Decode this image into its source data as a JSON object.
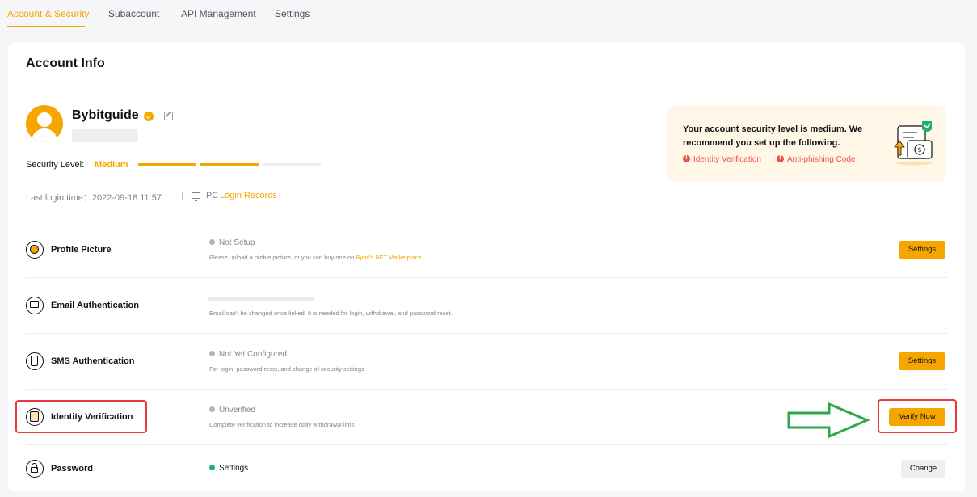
{
  "tabs": [
    "Account & Security",
    "Subaccount",
    "API Management",
    "Settings"
  ],
  "page_title": "Account Info",
  "profile": {
    "username": "Bybitguide",
    "security_label": "Security Level:",
    "security_value": "Medium",
    "security_level": "2 of 3",
    "last_login": "Last login time：2022-09-18 11:57",
    "login_separator": "|",
    "login_device": "PC",
    "login_records": "Login Records"
  },
  "notice": {
    "text": "Your account security level is medium. We recommend you set up the following.",
    "items": [
      "Identity Verification",
      "Anti-phishing Code"
    ]
  },
  "rows": [
    {
      "title": "Profile Picture",
      "status": "Not Setup",
      "desc": "Please upload a profile picture, or you can buy one on",
      "link": "Bybit's NFT Marketplace",
      "desc_end": ".",
      "action": "Settings"
    },
    {
      "title": "Email Authentication",
      "desc": "Email can't be changed once linked. It is needed for login, withdrawal, and password reset."
    },
    {
      "title": "SMS Authentication",
      "status": "Not Yet Configured",
      "desc": "For login, password reset, and change of security settings",
      "action": "Settings"
    },
    {
      "title": "Identity Verification",
      "status": "Unverified",
      "desc": "Complete verification to increase daily withdrawal limit",
      "action": "Verify Now"
    },
    {
      "title": "Password",
      "status": "Settings",
      "action": "Change"
    }
  ],
  "colors": {
    "accent": "#f7a600",
    "warning": "#f24e44",
    "success": "#20b26c",
    "annotation_box": "#e8393c",
    "annotation_arrow": "#2da84a"
  }
}
